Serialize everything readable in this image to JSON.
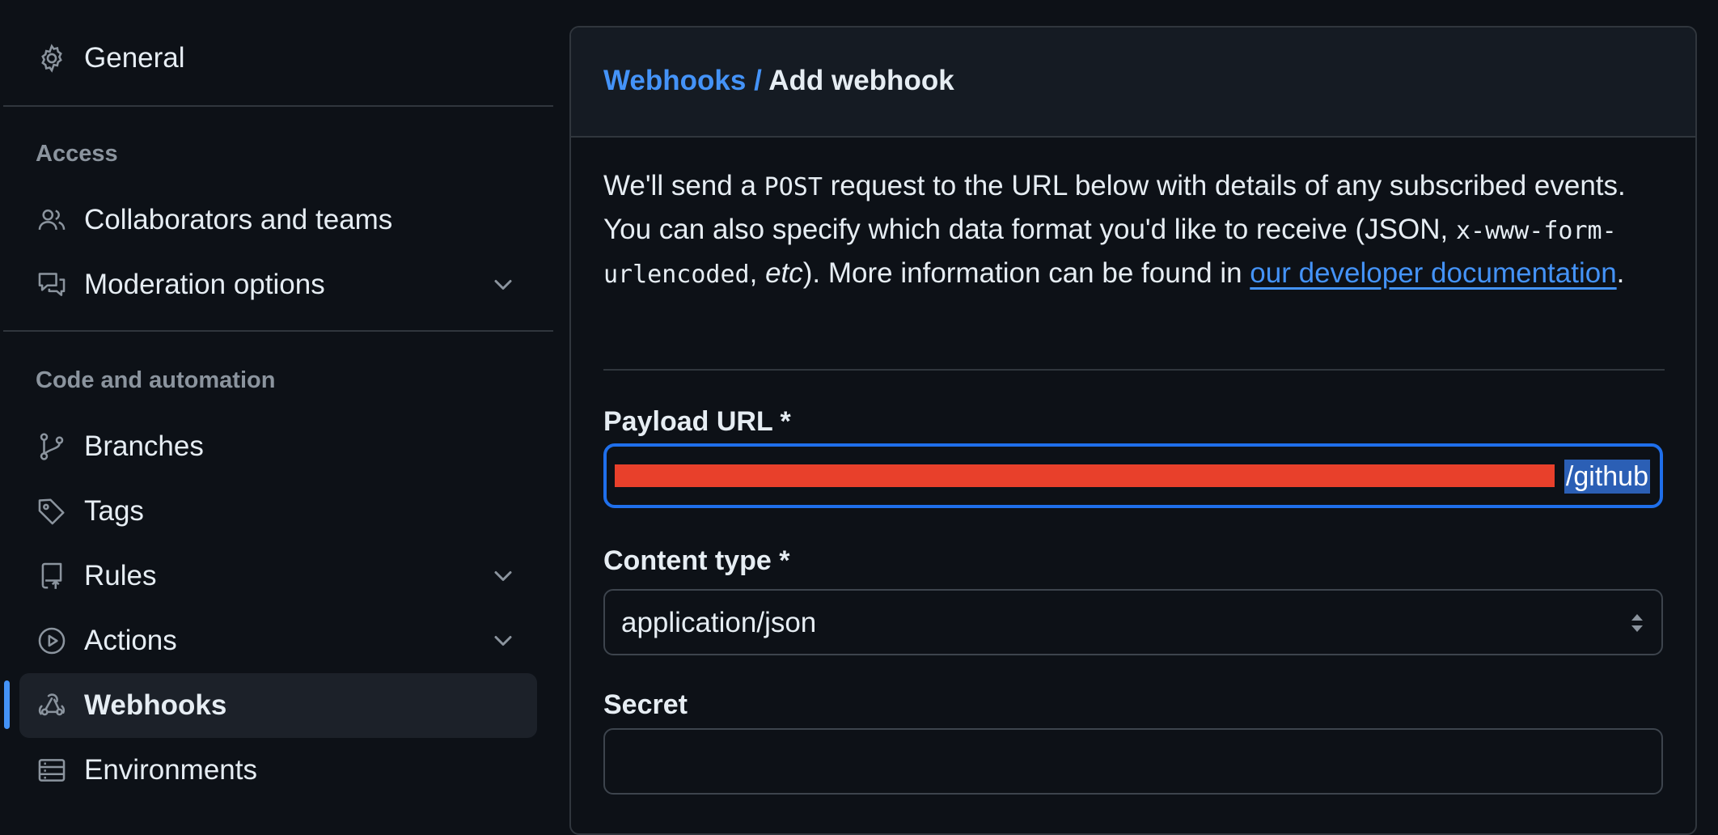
{
  "sidebar": {
    "general": {
      "label": "General",
      "icon": "gear-icon"
    },
    "sections": {
      "access": "Access",
      "code_automation": "Code and automation"
    },
    "access_items": [
      {
        "label": "Collaborators and teams",
        "icon": "people-icon"
      },
      {
        "label": "Moderation options",
        "icon": "comment-discussion-icon",
        "expandable": true
      }
    ],
    "code_items": [
      {
        "label": "Branches",
        "icon": "git-branch-icon"
      },
      {
        "label": "Tags",
        "icon": "tag-icon"
      },
      {
        "label": "Rules",
        "icon": "repo-push-icon",
        "expandable": true
      },
      {
        "label": "Actions",
        "icon": "play-icon",
        "expandable": true
      },
      {
        "label": "Webhooks",
        "icon": "webhook-icon",
        "active": true
      },
      {
        "label": "Environments",
        "icon": "server-icon"
      }
    ]
  },
  "main": {
    "breadcrumb": {
      "parent": "Webhooks",
      "separator": "/",
      "current": "Add webhook"
    },
    "intro": {
      "t1": "We'll send a ",
      "code1": "POST",
      "t2": " request to the URL below with details of any subscribed events. You can also specify which data format you'd like to receive (JSON, ",
      "code2": "x-www-form-urlencoded",
      "t3": ", ",
      "em": "etc",
      "t4": "). More information can be found in ",
      "link": "our developer documentation",
      "t5": "."
    },
    "payload_url": {
      "label": "Payload URL *",
      "visible_value": "/github",
      "redacted": true
    },
    "content_type": {
      "label": "Content type *",
      "value": "application/json"
    },
    "secret": {
      "label": "Secret",
      "value": ""
    }
  },
  "colors": {
    "background": "#0d1117",
    "accent": "#4493f8",
    "focus_border": "#1f6feb",
    "redaction": "#e8402b"
  }
}
